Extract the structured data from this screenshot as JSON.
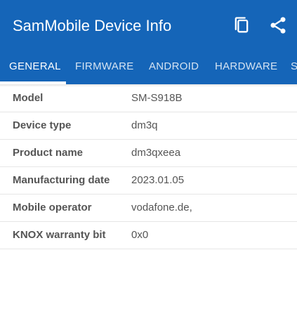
{
  "app": {
    "title": "SamMobile Device Info",
    "brand_color": "#1565b8",
    "actions": [
      {
        "name": "copy",
        "icon": "copy-icon"
      },
      {
        "name": "share",
        "icon": "share-icon"
      }
    ]
  },
  "tabs": [
    {
      "label": "GENERAL",
      "active": true
    },
    {
      "label": "FIRMWARE",
      "active": false
    },
    {
      "label": "ANDROID",
      "active": false
    },
    {
      "label": "HARDWARE",
      "active": false
    },
    {
      "label": "S",
      "active": false
    }
  ],
  "general": {
    "rows": [
      {
        "label": "Model",
        "value": "SM-S918B"
      },
      {
        "label": "Device type",
        "value": "dm3q"
      },
      {
        "label": "Product name",
        "value": "dm3qxeea"
      },
      {
        "label": "Manufacturing date",
        "value": "2023.01.05"
      },
      {
        "label": "Mobile operator",
        "value": "vodafone.de,"
      },
      {
        "label": "KNOX warranty bit",
        "value": "0x0"
      }
    ]
  }
}
